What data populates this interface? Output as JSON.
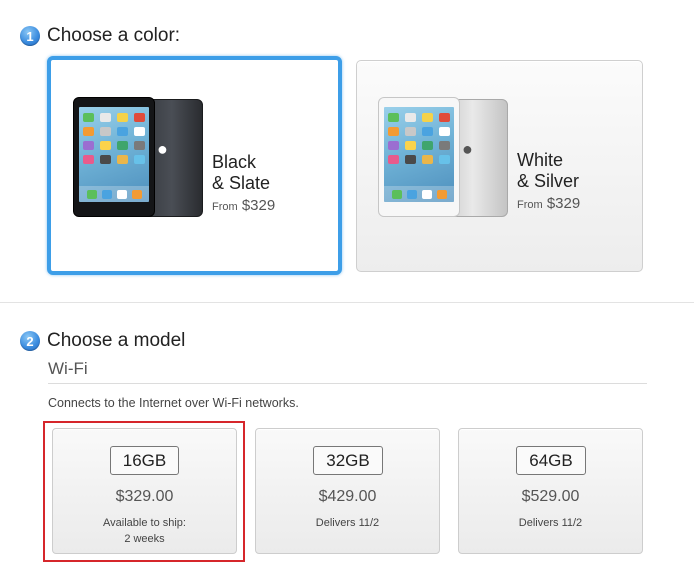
{
  "step1": {
    "number": "1",
    "title": "Choose a color:"
  },
  "colors": [
    {
      "name_line1": "Black",
      "name_line2": "& Slate",
      "from_label": "From",
      "price": "$329",
      "selected": true
    },
    {
      "name_line1": "White",
      "name_line2": "& Silver",
      "from_label": "From",
      "price": "$329",
      "selected": false
    }
  ],
  "step2": {
    "number": "2",
    "title": "Choose a model"
  },
  "connectivity": {
    "title": "Wi-Fi",
    "description": "Connects to the Internet over Wi-Fi networks."
  },
  "models": [
    {
      "capacity": "16GB",
      "price": "$329.00",
      "ship_line1": "Available to ship:",
      "ship_line2": "2 weeks",
      "selected": true
    },
    {
      "capacity": "32GB",
      "price": "$429.00",
      "ship_line1": "Delivers 11/2",
      "ship_line2": "",
      "selected": false
    },
    {
      "capacity": "64GB",
      "price": "$529.00",
      "ship_line1": "Delivers 11/2",
      "ship_line2": "",
      "selected": false
    }
  ],
  "colors_theme": {
    "accent_blue": "#3d9ee8",
    "selection_red": "#d6262b"
  }
}
